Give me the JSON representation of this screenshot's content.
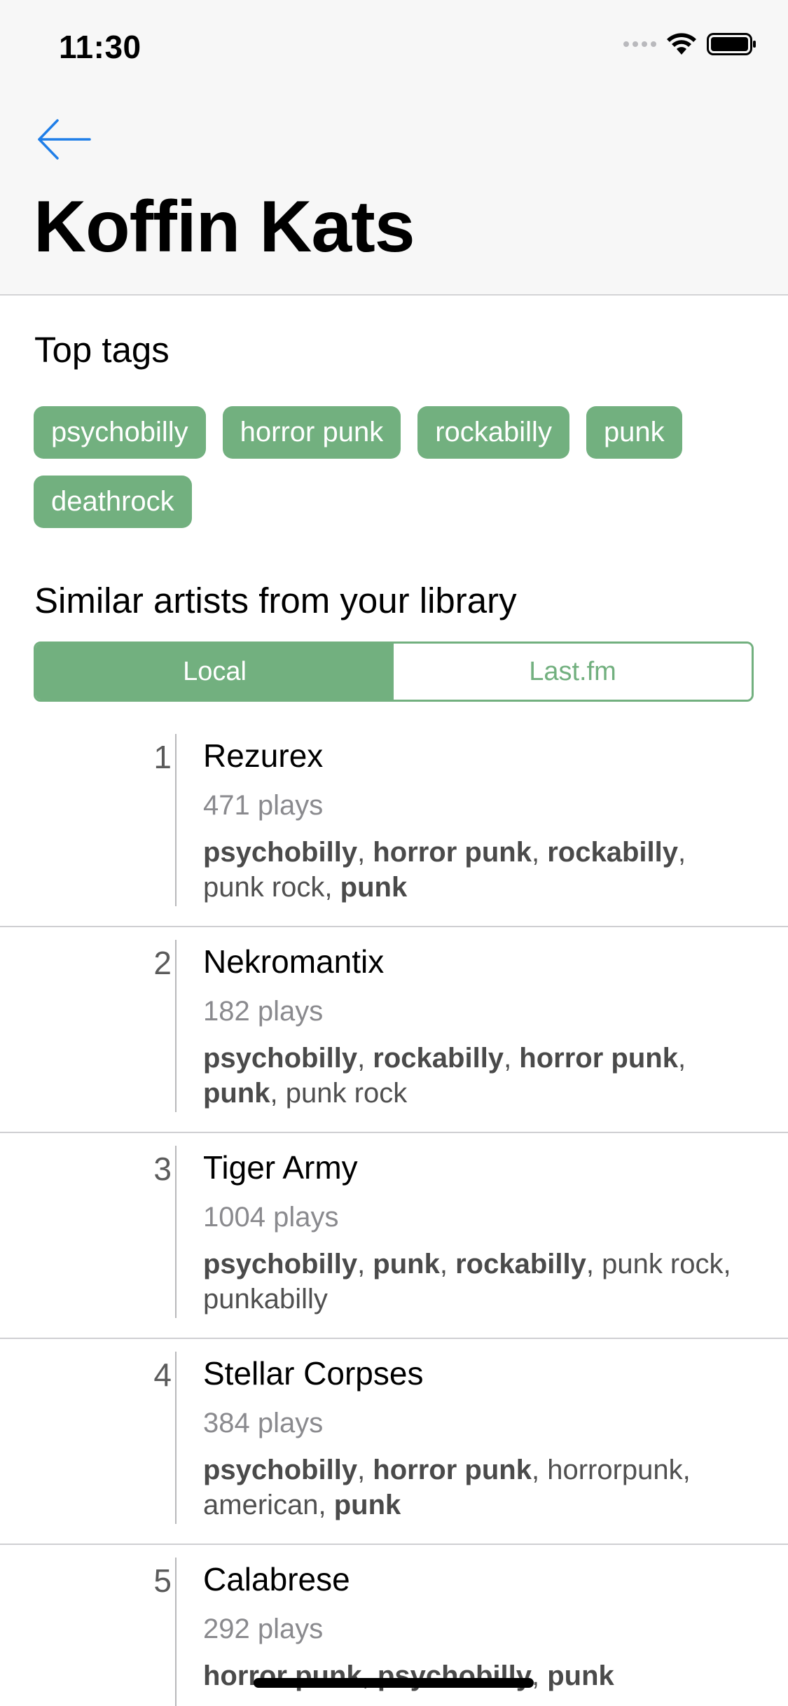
{
  "status_bar": {
    "time": "11:30"
  },
  "nav": {
    "back_icon": "arrow-left-icon",
    "title": "Koffin Kats",
    "accent_color": "#1f7ee8"
  },
  "top_tags": {
    "heading": "Top tags",
    "tags": [
      "psychobilly",
      "horror punk",
      "rockabilly",
      "punk",
      "deathrock"
    ],
    "tag_color": "#72b07f"
  },
  "similar": {
    "heading": "Similar artists from your library",
    "segments": [
      {
        "label": "Local",
        "selected": true
      },
      {
        "label": "Last.fm",
        "selected": false
      }
    ],
    "artists": [
      {
        "rank": "1",
        "name": "Rezurex",
        "plays": "471 plays",
        "tags": [
          {
            "text": "psychobilly",
            "bold": true
          },
          {
            "text": "horror punk",
            "bold": true
          },
          {
            "text": "rockabilly",
            "bold": true
          },
          {
            "text": "punk rock",
            "bold": false
          },
          {
            "text": "punk",
            "bold": true
          }
        ]
      },
      {
        "rank": "2",
        "name": "Nekromantix",
        "plays": "182 plays",
        "tags": [
          {
            "text": "psychobilly",
            "bold": true
          },
          {
            "text": "rockabilly",
            "bold": true
          },
          {
            "text": "horror punk",
            "bold": true
          },
          {
            "text": "punk",
            "bold": true
          },
          {
            "text": "punk rock",
            "bold": false
          }
        ]
      },
      {
        "rank": "3",
        "name": "Tiger Army",
        "plays": "1004 plays",
        "tags": [
          {
            "text": "psychobilly",
            "bold": true
          },
          {
            "text": "punk",
            "bold": true
          },
          {
            "text": "rockabilly",
            "bold": true
          },
          {
            "text": "punk rock",
            "bold": false
          },
          {
            "text": "punkabilly",
            "bold": false
          }
        ]
      },
      {
        "rank": "4",
        "name": "Stellar Corpses",
        "plays": "384 plays",
        "tags": [
          {
            "text": "psychobilly",
            "bold": true
          },
          {
            "text": "horror punk",
            "bold": true
          },
          {
            "text": "horrorpunk",
            "bold": false
          },
          {
            "text": "american",
            "bold": false
          },
          {
            "text": "punk",
            "bold": true
          }
        ]
      },
      {
        "rank": "5",
        "name": "Calabrese",
        "plays": "292 plays",
        "tags": [
          {
            "text": "horror punk",
            "bold": true
          },
          {
            "text": "psychobilly",
            "bold": true
          },
          {
            "text": "punk",
            "bold": true
          }
        ]
      }
    ]
  }
}
